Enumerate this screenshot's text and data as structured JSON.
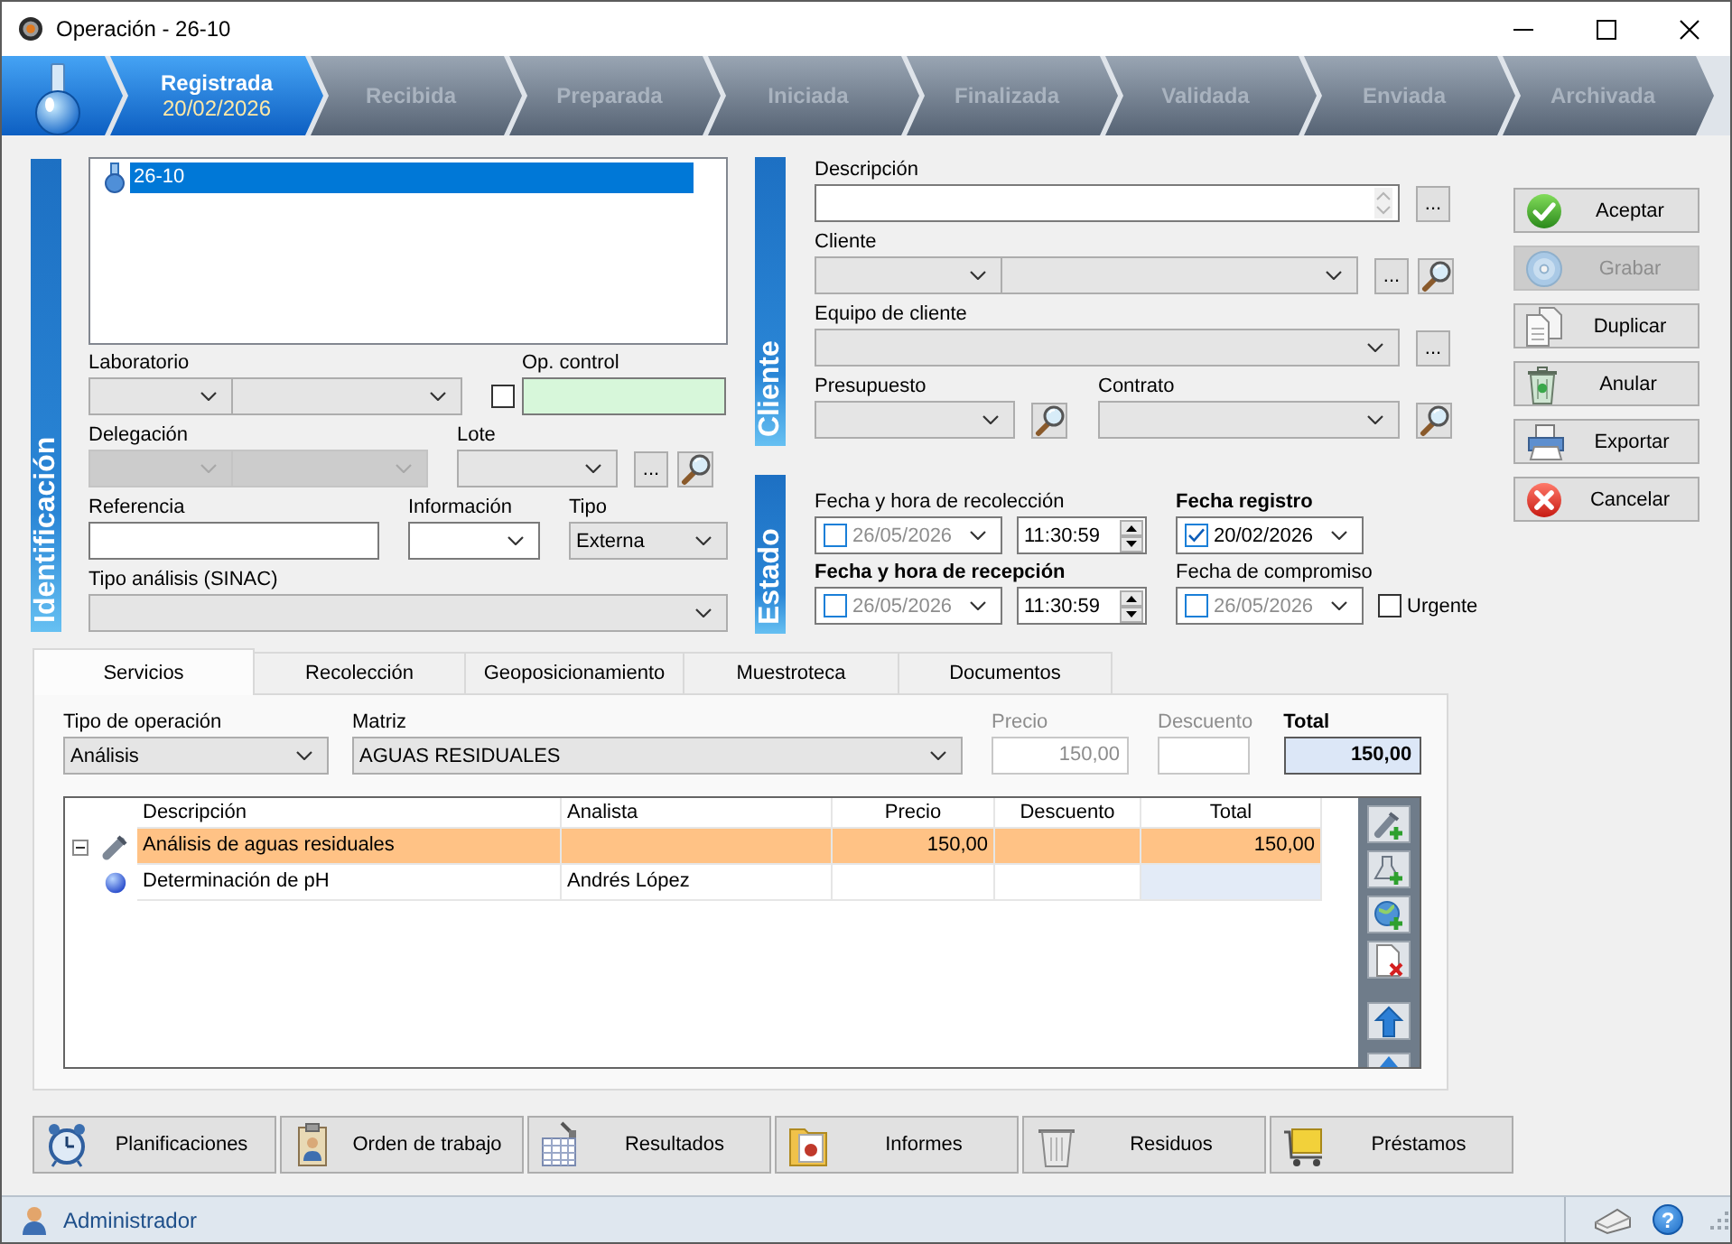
{
  "window": {
    "title": "Operación - 26-10"
  },
  "workflow": [
    {
      "label": "Registrada",
      "date": "20/02/2026",
      "selected": true
    },
    {
      "label": "Recibida",
      "selected": false
    },
    {
      "label": "Preparada",
      "selected": false
    },
    {
      "label": "Iniciada",
      "selected": false
    },
    {
      "label": "Finalizada",
      "selected": false
    },
    {
      "label": "Validada",
      "selected": false
    },
    {
      "label": "Enviada",
      "selected": false
    },
    {
      "label": "Archivada",
      "selected": false
    }
  ],
  "identificacion": {
    "section": "Identificación",
    "tree": [
      {
        "label": "26-10",
        "selected": true
      }
    ],
    "laboratorio": {
      "label": "Laboratorio"
    },
    "op_control": {
      "label": "Op. control",
      "checked": false
    },
    "delegacion": {
      "label": "Delegación",
      "disabled": true
    },
    "lote": {
      "label": "Lote",
      "more": "..."
    },
    "referencia": {
      "label": "Referencia"
    },
    "informacion": {
      "label": "Información",
      "editable": true
    },
    "tipo": {
      "label": "Tipo",
      "value": "Externa"
    },
    "tipo_analisis": {
      "label": "Tipo análisis (SINAC)"
    }
  },
  "cliente": {
    "section": "Cliente",
    "descripcion": {
      "label": "Descripción",
      "more": "..."
    },
    "cliente": {
      "label": "Cliente",
      "more": "..."
    },
    "equipo": {
      "label": "Equipo de cliente",
      "more": "..."
    },
    "presupuesto": {
      "label": "Presupuesto"
    },
    "contrato": {
      "label": "Contrato"
    }
  },
  "estado": {
    "section": "Estado",
    "fields": [
      {
        "kind": "datetime",
        "label": "Fecha y hora de recolección",
        "required": false,
        "checked": false,
        "date": "26/05/2026",
        "time": "11:30:59"
      },
      {
        "kind": "date",
        "label": "Fecha registro",
        "required": true,
        "checked": true,
        "date": "20/02/2026"
      },
      {
        "kind": "datetime",
        "label": "Fecha y hora de recepción",
        "required": true,
        "checked": false,
        "date": "26/05/2026",
        "time": "11:30:59"
      },
      {
        "kind": "date",
        "label": "Fecha de compromiso",
        "required": false,
        "checked": false,
        "date": "26/05/2026"
      },
      {
        "kind": "checkbox",
        "label": "Urgente",
        "checked": false
      }
    ]
  },
  "actions": [
    {
      "kind": "accept",
      "label": "Aceptar",
      "disabled": false
    },
    {
      "kind": "save",
      "label": "Grabar",
      "disabled": true
    },
    {
      "kind": "duplicate",
      "label": "Duplicar",
      "disabled": false
    },
    {
      "kind": "void",
      "label": "Anular",
      "disabled": false
    },
    {
      "kind": "export",
      "label": "Exportar",
      "disabled": false
    },
    {
      "kind": "cancel",
      "label": "Cancelar",
      "disabled": false
    }
  ],
  "tabs": [
    {
      "label": "Servicios",
      "selected": true
    },
    {
      "label": "Recolección",
      "selected": false
    },
    {
      "label": "Geoposicionamiento",
      "selected": false
    },
    {
      "label": "Muestroteca",
      "selected": false
    },
    {
      "label": "Documentos",
      "selected": false
    }
  ],
  "servicios": {
    "tipo_operacion": {
      "label": "Tipo de operación",
      "value": "Análisis"
    },
    "matriz": {
      "label": "Matriz",
      "value": "AGUAS RESIDUALES"
    },
    "amounts": [
      {
        "kind": "readonly",
        "label": "Precio",
        "value": "150,00"
      },
      {
        "kind": "disabled",
        "label": "Descuento"
      },
      {
        "kind": "total",
        "label": "Total",
        "value": "150,00"
      }
    ],
    "grid": {
      "columns": [
        "Descripción",
        "Analista",
        "Precio",
        "Descuento",
        "Total"
      ],
      "rows": [
        {
          "kind": "analysis",
          "expanded": true,
          "selected": true,
          "description": "Análisis de aguas residuales",
          "price": "150,00",
          "total": "150,00",
          "children": [
            {
              "kind": "determination",
              "selected": false,
              "description": "Determinación de pH",
              "analyst": "Andrés López"
            }
          ]
        }
      ]
    }
  },
  "modules": [
    {
      "kind": "planning",
      "label": "Planificaciones"
    },
    {
      "kind": "work-order",
      "label": "Orden de trabajo"
    },
    {
      "kind": "results",
      "label": "Resultados"
    },
    {
      "kind": "reports",
      "label": "Informes"
    },
    {
      "kind": "waste",
      "label": "Residuos"
    },
    {
      "kind": "loans",
      "label": "Préstamos"
    }
  ],
  "status_bar": {
    "user": "Administrador",
    "help": "?"
  }
}
